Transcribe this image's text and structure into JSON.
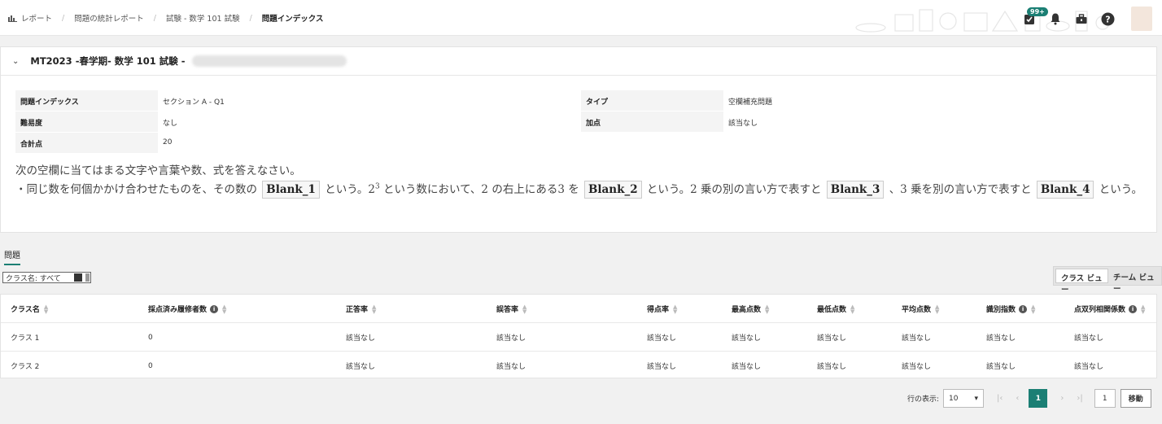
{
  "breadcrumb": {
    "items": [
      "レポート",
      "問題の統計レポート",
      "試験 - 数学 101 試験",
      "問題インデックス"
    ]
  },
  "header": {
    "task_badge": "99+",
    "icons": [
      "task-icon",
      "bell-icon",
      "toolbox-icon",
      "help-icon",
      "avatar"
    ]
  },
  "exam": {
    "title": "MT2023 -春学期- 数学 101 試験 -",
    "info": {
      "question_index_label": "問題インデックス",
      "question_index_value": "セクション A - Q1",
      "type_label": "タイプ",
      "type_value": "空欄補充問題",
      "difficulty_label": "難易度",
      "difficulty_value": "なし",
      "bonus_label": "加点",
      "bonus_value": "該当なし",
      "total_label": "合計点",
      "total_value": "20"
    },
    "question": {
      "line1": "次の空欄に当てはまる文字や言葉や数、式を答えなさい。",
      "p1": "・同じ数を何個かかけ合わせたものを、その数の",
      "blank1": "Blank_1",
      "p2": "という。2",
      "sup": "3",
      "p3": "という数において、2 の右上にある3 を",
      "blank2": "Blank_2",
      "p4": "という。2 乗の別の言い方で表すと",
      "blank3": "Blank_3",
      "p5": "、3 乗を別の言い方で表すと",
      "blank4": "Blank_4",
      "p6": "という。"
    }
  },
  "tabs": {
    "questions": "問題"
  },
  "filter": {
    "label": "クラス名: すべて"
  },
  "view_toggle": {
    "class_view": "クラス ビュー",
    "team_view": "チーム ビュー"
  },
  "table": {
    "headers": [
      "クラス名",
      "採点済み履修者数",
      "正答率",
      "誤答率",
      "得点率",
      "最高点数",
      "最低点数",
      "平均点数",
      "識別指数",
      "点双列相関係数"
    ],
    "rows": [
      [
        "クラス 1",
        "0",
        "該当なし",
        "該当なし",
        "該当なし",
        "該当なし",
        "該当なし",
        "該当なし",
        "該当なし",
        "該当なし"
      ],
      [
        "クラス 2",
        "0",
        "該当なし",
        "該当なし",
        "該当なし",
        "該当なし",
        "該当なし",
        "該当なし",
        "該当なし",
        "該当なし"
      ]
    ]
  },
  "pagination": {
    "rows_label": "行の表示:",
    "rows_value": "10",
    "current_page": "1",
    "goto_value": "1",
    "goto_button": "移動"
  },
  "colors": {
    "accent": "#1b7f74"
  }
}
